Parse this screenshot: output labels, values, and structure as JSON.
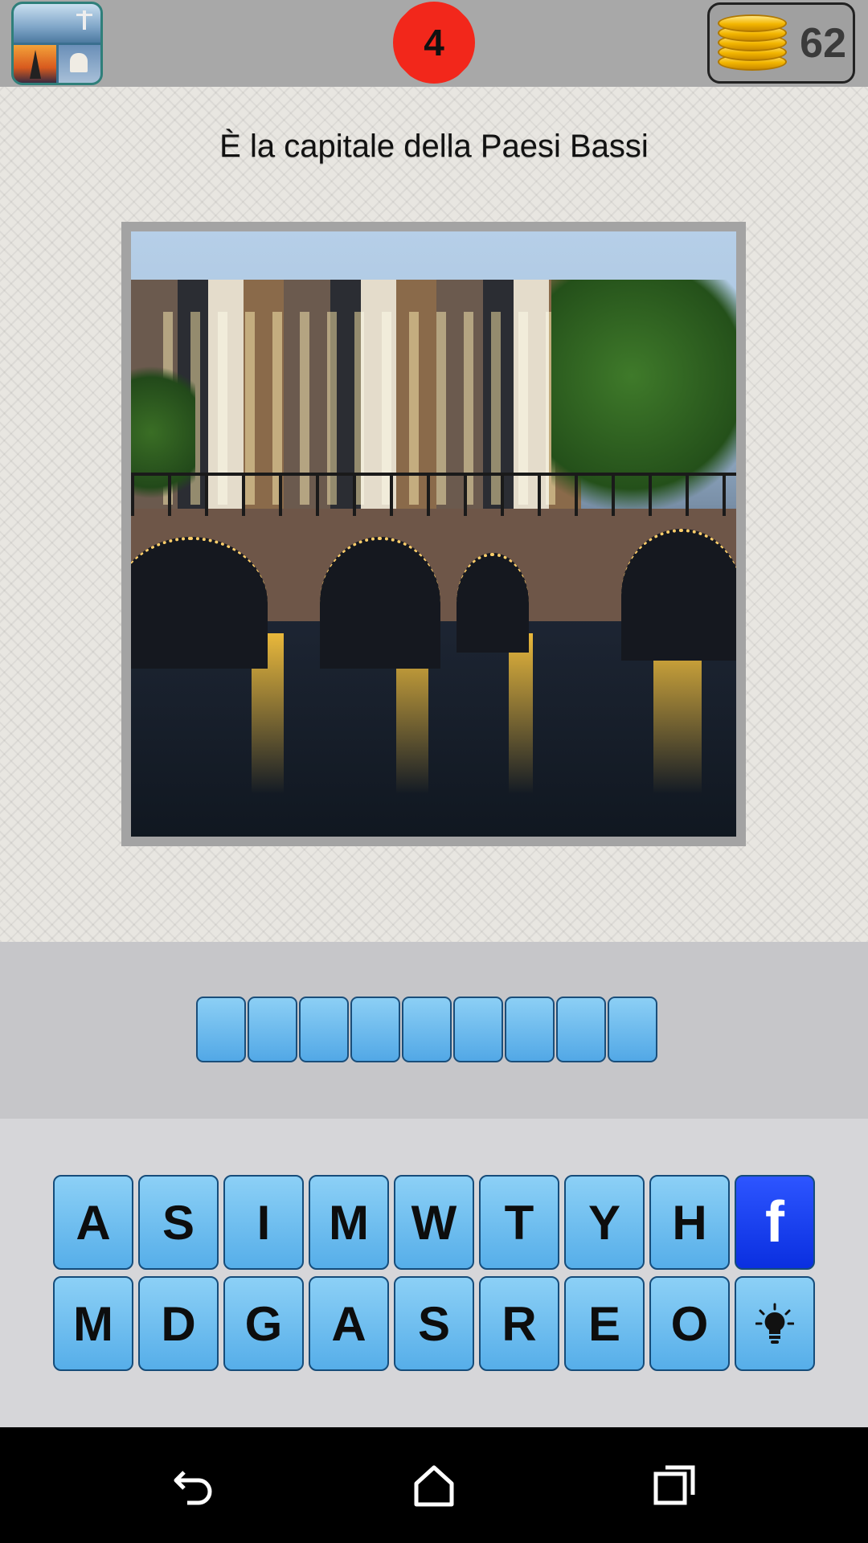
{
  "header": {
    "level": "4",
    "coins": "62"
  },
  "question": {
    "text": "È la capitale della Paesi Bassi"
  },
  "answer": {
    "slot_count": 9
  },
  "keyboard": {
    "row1": [
      "A",
      "S",
      "I",
      "M",
      "W",
      "T",
      "Y",
      "H"
    ],
    "row2": [
      "M",
      "D",
      "G",
      "A",
      "S",
      "R",
      "E",
      "O"
    ],
    "facebook_label": "f",
    "hint_icon": "lightbulb-icon"
  },
  "colors": {
    "key_blue": "#56aee9",
    "facebook_blue": "#0a2fe0",
    "level_badge": "#f2271b"
  },
  "navigation": {
    "icons": [
      "back-icon",
      "home-icon",
      "recents-icon"
    ]
  }
}
